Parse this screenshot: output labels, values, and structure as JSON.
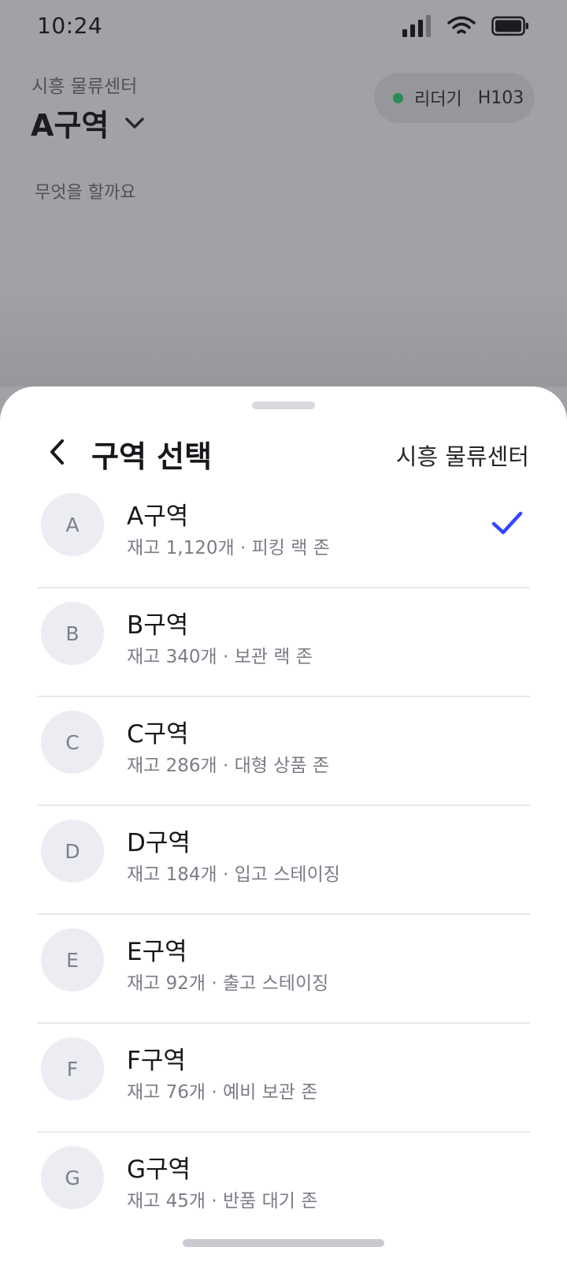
{
  "status_bar": {
    "time": "10:24"
  },
  "background": {
    "center_name": "시흥 물류센터",
    "zone_title": "A구역",
    "device": {
      "label": "리더기",
      "code": "H103",
      "status_color": "#2a8a55"
    },
    "prompt": "무엇을 할까요"
  },
  "sheet": {
    "title": "구역 선택",
    "center_name": "시흥 물류센터",
    "accent_color": "#3347ff",
    "selected_zone": "A",
    "zones": [
      {
        "letter": "A",
        "name": "A구역",
        "desc": "재고 1,120개 · 피킹 랙 존"
      },
      {
        "letter": "B",
        "name": "B구역",
        "desc": "재고 340개 · 보관 랙 존"
      },
      {
        "letter": "C",
        "name": "C구역",
        "desc": "재고 286개 · 대형 상품 존"
      },
      {
        "letter": "D",
        "name": "D구역",
        "desc": "재고 184개 · 입고 스테이징"
      },
      {
        "letter": "E",
        "name": "E구역",
        "desc": "재고 92개 · 출고 스테이징"
      },
      {
        "letter": "F",
        "name": "F구역",
        "desc": "재고 76개 · 예비 보관 존"
      },
      {
        "letter": "G",
        "name": "G구역",
        "desc": "재고 45개 · 반품 대기 존"
      }
    ]
  }
}
